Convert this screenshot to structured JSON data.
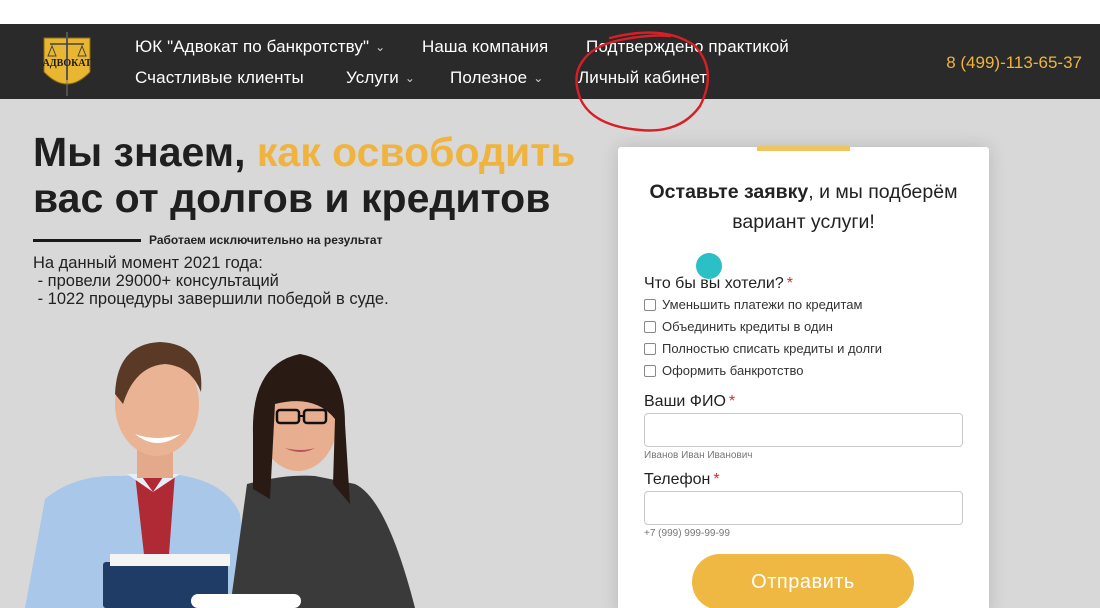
{
  "header": {
    "nav": [
      {
        "label": "ЮК \"Адвокат по банкротству\"",
        "has_dropdown": true
      },
      {
        "label": "Наша компания",
        "has_dropdown": false
      },
      {
        "label": "Подтверждено практикой",
        "has_dropdown": false
      },
      {
        "label": "Счастливые клиенты",
        "has_dropdown": false
      },
      {
        "label": "Услуги",
        "has_dropdown": true
      },
      {
        "label": "Полезное",
        "has_dropdown": true
      },
      {
        "label": "Личный кабинет",
        "has_dropdown": false
      }
    ],
    "phone": "8 (499)-113-65-37",
    "logo_text": "АДВОКАТ"
  },
  "hero": {
    "headline_part1": "Мы знаем, ",
    "headline_accent": "как освободить",
    "headline_line2": "вас от долгов и кредитов",
    "tagline": "Работаем исключительно на результат",
    "stats": [
      "На данный момент 2021 года:",
      " - провели 29000+ консультаций",
      " - 1022 процедуры завершили победой в суде."
    ]
  },
  "form": {
    "title_bold": "Оставьте заявку",
    "title_rest": ", и мы подберём вариант услуги!",
    "question_label": "Что бы вы хотели?",
    "required_mark": "*",
    "options": [
      "Уменьшить платежи по кредитам",
      "Объединить кредиты в один",
      "Полностью списать кредиты и долги",
      "Оформить банкротство"
    ],
    "name_label": "Ваши ФИО",
    "name_value": "",
    "name_hint": "Иванов Иван Иванович",
    "phone_label": "Телефон",
    "phone_value": "",
    "phone_hint": "+7 (999) 999-99-99",
    "submit_label": "Отправить"
  },
  "colors": {
    "header_bg": "#2a2a2a",
    "accent": "#efb440",
    "hero_bg": "#d8d8d8",
    "annotation": "#d81f26"
  },
  "icons": [
    "chevron-down-icon",
    "logo-scales-icon"
  ]
}
